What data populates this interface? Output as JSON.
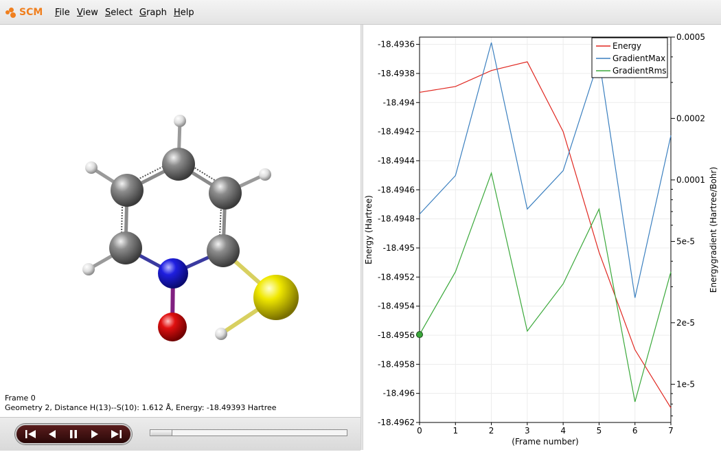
{
  "app": {
    "logo_text": "SCM"
  },
  "menu": [
    {
      "label": "File",
      "accel": "F",
      "rest": "ile"
    },
    {
      "label": "View",
      "accel": "V",
      "rest": "iew"
    },
    {
      "label": "Select",
      "accel": "S",
      "rest": "elect"
    },
    {
      "label": "Graph",
      "accel": "G",
      "rest": "raph"
    },
    {
      "label": "Help",
      "accel": "H",
      "rest": "elp"
    }
  ],
  "viewer": {
    "frame_label": "Frame 0",
    "geometry_label": "Geometry 2, Distance H(13)--S(10): 1.612 Å, Energy: -18.49393 Hartree",
    "atom_colors": {
      "carbon": "#7a7a7a",
      "hydrogen": "#e8e8e8",
      "nitrogen": "#1f1fe0",
      "oxygen": "#e01010",
      "sulfur": "#e8e000"
    }
  },
  "player": {
    "buttons": [
      "first-frame",
      "previous-frame",
      "pause",
      "next-frame",
      "last-frame"
    ],
    "slider_position": 0
  },
  "chart_data": {
    "type": "line",
    "xlabel": "(Frame number)",
    "ylabel_left": "Energy (Hartree)",
    "ylabel_right": "Energygradient (Hartree/Bohr)",
    "x": [
      0,
      1,
      2,
      3,
      4,
      5,
      6,
      7
    ],
    "xlim": [
      0,
      7
    ],
    "ylim_left": [
      -18.4962,
      -18.49355
    ],
    "ylim_right_log": [
      6.5e-06,
      0.0005
    ],
    "left_ticks": [
      "-18.4936",
      "-18.4938",
      "-18.494",
      "-18.4942",
      "-18.4944",
      "-18.4946",
      "-18.4948",
      "-18.495",
      "-18.4952",
      "-18.4954",
      "-18.4956",
      "-18.4958",
      "-18.496",
      "-18.4962"
    ],
    "left_tick_values": [
      -18.4936,
      -18.4938,
      -18.494,
      -18.4942,
      -18.4944,
      -18.4946,
      -18.4948,
      -18.495,
      -18.4952,
      -18.4954,
      -18.4956,
      -18.4958,
      -18.496,
      -18.4962
    ],
    "right_ticks": [
      {
        "label": "0.0005",
        "value": 0.0005
      },
      {
        "label": "0.0002",
        "value": 0.0002
      },
      {
        "label": "0.0001",
        "value": 0.0001
      },
      {
        "label": "5e-5",
        "value": 5e-05
      },
      {
        "label": "2e-5",
        "value": 2e-05
      },
      {
        "label": "1e-5",
        "value": 1e-05
      }
    ],
    "grid": true,
    "legend_position": "top-right",
    "series": [
      {
        "name": "Energy",
        "axis": "left",
        "color": "#e0261f",
        "values": [
          -18.49393,
          -18.49389,
          -18.49378,
          -18.49372,
          -18.4942,
          -18.49503,
          -18.4957,
          -18.4961
        ]
      },
      {
        "name": "GradientMax",
        "axis": "right",
        "color": "#3a7fbf",
        "values": [
          6.8e-05,
          0.000105,
          0.00047,
          7.2e-05,
          0.000111,
          0.00039,
          2.65e-05,
          0.000165
        ]
      },
      {
        "name": "GradientRms",
        "axis": "right",
        "color": "#3aa83a",
        "values": [
          1.75e-05,
          3.55e-05,
          0.000108,
          1.82e-05,
          3.1e-05,
          7.2e-05,
          8.2e-06,
          3.55e-05
        ]
      }
    ],
    "marker": {
      "series": "GradientRms",
      "x": 0
    }
  }
}
